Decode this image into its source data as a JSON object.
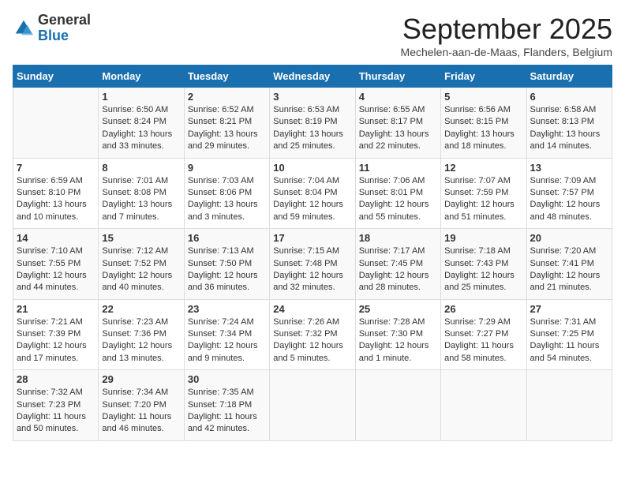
{
  "logo": {
    "general": "General",
    "blue": "Blue"
  },
  "title": "September 2025",
  "location": "Mechelen-aan-de-Maas, Flanders, Belgium",
  "days_header": [
    "Sunday",
    "Monday",
    "Tuesday",
    "Wednesday",
    "Thursday",
    "Friday",
    "Saturday"
  ],
  "weeks": [
    [
      {
        "num": "",
        "sunrise": "",
        "sunset": "",
        "daylight": ""
      },
      {
        "num": "1",
        "sunrise": "Sunrise: 6:50 AM",
        "sunset": "Sunset: 8:24 PM",
        "daylight": "Daylight: 13 hours and 33 minutes."
      },
      {
        "num": "2",
        "sunrise": "Sunrise: 6:52 AM",
        "sunset": "Sunset: 8:21 PM",
        "daylight": "Daylight: 13 hours and 29 minutes."
      },
      {
        "num": "3",
        "sunrise": "Sunrise: 6:53 AM",
        "sunset": "Sunset: 8:19 PM",
        "daylight": "Daylight: 13 hours and 25 minutes."
      },
      {
        "num": "4",
        "sunrise": "Sunrise: 6:55 AM",
        "sunset": "Sunset: 8:17 PM",
        "daylight": "Daylight: 13 hours and 22 minutes."
      },
      {
        "num": "5",
        "sunrise": "Sunrise: 6:56 AM",
        "sunset": "Sunset: 8:15 PM",
        "daylight": "Daylight: 13 hours and 18 minutes."
      },
      {
        "num": "6",
        "sunrise": "Sunrise: 6:58 AM",
        "sunset": "Sunset: 8:13 PM",
        "daylight": "Daylight: 13 hours and 14 minutes."
      }
    ],
    [
      {
        "num": "7",
        "sunrise": "Sunrise: 6:59 AM",
        "sunset": "Sunset: 8:10 PM",
        "daylight": "Daylight: 13 hours and 10 minutes."
      },
      {
        "num": "8",
        "sunrise": "Sunrise: 7:01 AM",
        "sunset": "Sunset: 8:08 PM",
        "daylight": "Daylight: 13 hours and 7 minutes."
      },
      {
        "num": "9",
        "sunrise": "Sunrise: 7:03 AM",
        "sunset": "Sunset: 8:06 PM",
        "daylight": "Daylight: 13 hours and 3 minutes."
      },
      {
        "num": "10",
        "sunrise": "Sunrise: 7:04 AM",
        "sunset": "Sunset: 8:04 PM",
        "daylight": "Daylight: 12 hours and 59 minutes."
      },
      {
        "num": "11",
        "sunrise": "Sunrise: 7:06 AM",
        "sunset": "Sunset: 8:01 PM",
        "daylight": "Daylight: 12 hours and 55 minutes."
      },
      {
        "num": "12",
        "sunrise": "Sunrise: 7:07 AM",
        "sunset": "Sunset: 7:59 PM",
        "daylight": "Daylight: 12 hours and 51 minutes."
      },
      {
        "num": "13",
        "sunrise": "Sunrise: 7:09 AM",
        "sunset": "Sunset: 7:57 PM",
        "daylight": "Daylight: 12 hours and 48 minutes."
      }
    ],
    [
      {
        "num": "14",
        "sunrise": "Sunrise: 7:10 AM",
        "sunset": "Sunset: 7:55 PM",
        "daylight": "Daylight: 12 hours and 44 minutes."
      },
      {
        "num": "15",
        "sunrise": "Sunrise: 7:12 AM",
        "sunset": "Sunset: 7:52 PM",
        "daylight": "Daylight: 12 hours and 40 minutes."
      },
      {
        "num": "16",
        "sunrise": "Sunrise: 7:13 AM",
        "sunset": "Sunset: 7:50 PM",
        "daylight": "Daylight: 12 hours and 36 minutes."
      },
      {
        "num": "17",
        "sunrise": "Sunrise: 7:15 AM",
        "sunset": "Sunset: 7:48 PM",
        "daylight": "Daylight: 12 hours and 32 minutes."
      },
      {
        "num": "18",
        "sunrise": "Sunrise: 7:17 AM",
        "sunset": "Sunset: 7:45 PM",
        "daylight": "Daylight: 12 hours and 28 minutes."
      },
      {
        "num": "19",
        "sunrise": "Sunrise: 7:18 AM",
        "sunset": "Sunset: 7:43 PM",
        "daylight": "Daylight: 12 hours and 25 minutes."
      },
      {
        "num": "20",
        "sunrise": "Sunrise: 7:20 AM",
        "sunset": "Sunset: 7:41 PM",
        "daylight": "Daylight: 12 hours and 21 minutes."
      }
    ],
    [
      {
        "num": "21",
        "sunrise": "Sunrise: 7:21 AM",
        "sunset": "Sunset: 7:39 PM",
        "daylight": "Daylight: 12 hours and 17 minutes."
      },
      {
        "num": "22",
        "sunrise": "Sunrise: 7:23 AM",
        "sunset": "Sunset: 7:36 PM",
        "daylight": "Daylight: 12 hours and 13 minutes."
      },
      {
        "num": "23",
        "sunrise": "Sunrise: 7:24 AM",
        "sunset": "Sunset: 7:34 PM",
        "daylight": "Daylight: 12 hours and 9 minutes."
      },
      {
        "num": "24",
        "sunrise": "Sunrise: 7:26 AM",
        "sunset": "Sunset: 7:32 PM",
        "daylight": "Daylight: 12 hours and 5 minutes."
      },
      {
        "num": "25",
        "sunrise": "Sunrise: 7:28 AM",
        "sunset": "Sunset: 7:30 PM",
        "daylight": "Daylight: 12 hours and 1 minute."
      },
      {
        "num": "26",
        "sunrise": "Sunrise: 7:29 AM",
        "sunset": "Sunset: 7:27 PM",
        "daylight": "Daylight: 11 hours and 58 minutes."
      },
      {
        "num": "27",
        "sunrise": "Sunrise: 7:31 AM",
        "sunset": "Sunset: 7:25 PM",
        "daylight": "Daylight: 11 hours and 54 minutes."
      }
    ],
    [
      {
        "num": "28",
        "sunrise": "Sunrise: 7:32 AM",
        "sunset": "Sunset: 7:23 PM",
        "daylight": "Daylight: 11 hours and 50 minutes."
      },
      {
        "num": "29",
        "sunrise": "Sunrise: 7:34 AM",
        "sunset": "Sunset: 7:20 PM",
        "daylight": "Daylight: 11 hours and 46 minutes."
      },
      {
        "num": "30",
        "sunrise": "Sunrise: 7:35 AM",
        "sunset": "Sunset: 7:18 PM",
        "daylight": "Daylight: 11 hours and 42 minutes."
      },
      {
        "num": "",
        "sunrise": "",
        "sunset": "",
        "daylight": ""
      },
      {
        "num": "",
        "sunrise": "",
        "sunset": "",
        "daylight": ""
      },
      {
        "num": "",
        "sunrise": "",
        "sunset": "",
        "daylight": ""
      },
      {
        "num": "",
        "sunrise": "",
        "sunset": "",
        "daylight": ""
      }
    ]
  ]
}
